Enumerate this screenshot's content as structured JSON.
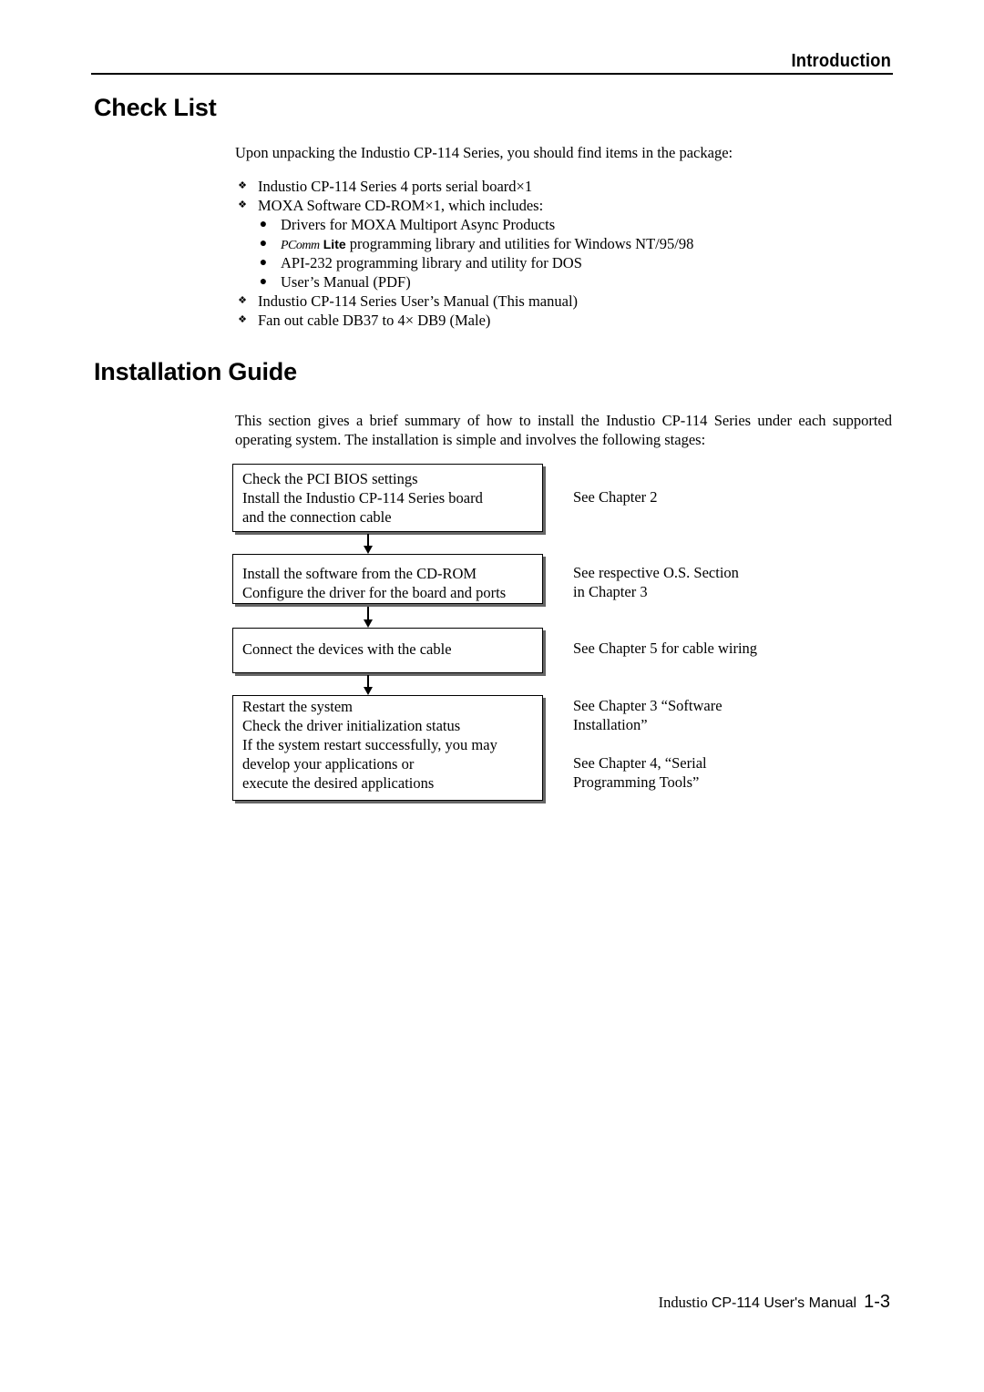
{
  "header": {
    "section_title": "Introduction"
  },
  "check_list": {
    "title": "Check List",
    "intro": "Upon unpacking the Industio CP-114 Series, you should find items in the package:",
    "items": [
      {
        "bullet": "❖",
        "text": "Industio CP-114 Series 4 ports serial board×1"
      },
      {
        "bullet": "❖",
        "text": "MOXA Software CD-ROM×1, which includes:"
      },
      {
        "bullet": "●",
        "text": "Drivers for MOXA Multiport Async Products"
      },
      {
        "bullet": "●",
        "brand_italic": "PComm",
        "brand_bold": "Lite",
        "text": " programming library and utilities for Windows NT/95/98"
      },
      {
        "bullet": "●",
        "text": "API-232 programming library and utility for DOS"
      },
      {
        "bullet": "●",
        "text": "User’s Manual (PDF)"
      },
      {
        "bullet": "❖",
        "text": "Industio CP-114 Series  User’s Manual (This manual)"
      },
      {
        "bullet": "❖",
        "text": "Fan out cable DB37 to 4× DB9 (Male)"
      }
    ]
  },
  "installation_guide": {
    "title": "Installation Guide",
    "intro": "This section gives a brief summary of how to install the Industio CP-114 Series under each supported operating system. The installation is simple and involves the following stages:",
    "steps": [
      {
        "lines": [
          "Check the PCI BIOS settings",
          "Install the Industio CP-114 Series board",
          "and the connection cable"
        ]
      },
      {
        "lines": [
          "Install the software from the CD-ROM",
          "Configure the driver for the board and ports"
        ]
      },
      {
        "lines": [
          "Connect the devices with the cable"
        ]
      },
      {
        "lines": [
          "Restart the system",
          "Check the driver initialization status",
          "If the system restart successfully, you may",
          "develop your applications or",
          "execute the desired applications"
        ]
      }
    ],
    "notes": [
      {
        "lines": [
          "See Chapter 2"
        ]
      },
      {
        "lines": [
          "See respective O.S. Section",
          "in Chapter 3"
        ]
      },
      {
        "lines": [
          "See Chapter 5 for cable wiring"
        ]
      },
      {
        "lines": [
          "See Chapter 3 “Software",
          "Installation”"
        ]
      },
      {
        "lines": [
          "See Chapter 4, “Serial",
          "Programming Tools”"
        ]
      }
    ]
  },
  "footer": {
    "brand": "Industio ",
    "product": "CP-114 User's Manual",
    "page_number": "1-3"
  }
}
